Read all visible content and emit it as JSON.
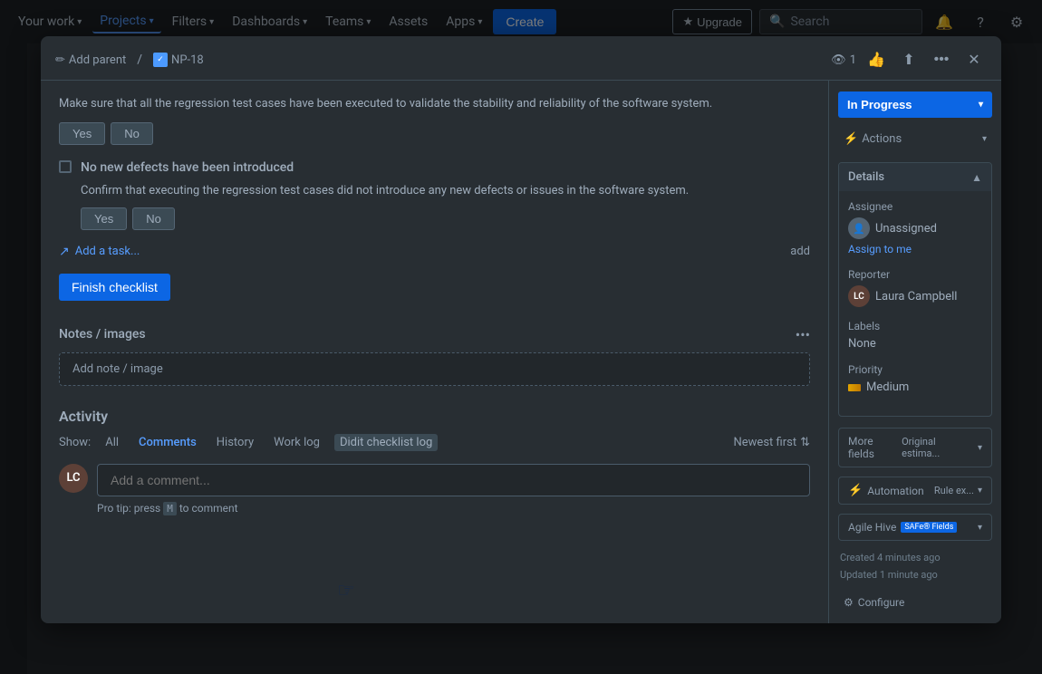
{
  "topnav": {
    "items": [
      {
        "label": "Your work",
        "hasChevron": true,
        "active": false
      },
      {
        "label": "Projects",
        "hasChevron": true,
        "active": true
      },
      {
        "label": "Filters",
        "hasChevron": true,
        "active": false
      },
      {
        "label": "Dashboards",
        "hasChevron": true,
        "active": false
      },
      {
        "label": "Teams",
        "hasChevron": true,
        "active": false
      },
      {
        "label": "Assets",
        "hasChevron": false,
        "active": false
      },
      {
        "label": "Apps",
        "hasChevron": true,
        "active": false
      }
    ],
    "create_label": "Create",
    "upgrade_label": "Upgrade",
    "search_placeholder": "Search"
  },
  "modal": {
    "breadcrumb_parent": "Add parent",
    "breadcrumb_sep": "/",
    "breadcrumb_id": "NP-18",
    "watch_count": "1",
    "status": "In Progress",
    "actions_label": "Actions",
    "checklist": {
      "description": "Make sure that all the regression test cases have been executed to validate the stability and reliability of the software system.",
      "yes_label": "Yes",
      "no_label": "No",
      "item_title": "No new defects have been introduced",
      "item_description": "Confirm that executing the regression test cases did not introduce any new defects or issues in the software system.",
      "add_task_label": "Add a task...",
      "add_label": "add"
    },
    "finish_checklist_label": "Finish checklist",
    "notes": {
      "title": "Notes / images",
      "add_label": "Add note / image"
    },
    "activity": {
      "title": "Activity",
      "show_label": "Show:",
      "filters": [
        {
          "label": "All",
          "active": false
        },
        {
          "label": "Comments",
          "active": true
        },
        {
          "label": "History",
          "active": false
        },
        {
          "label": "Work log",
          "active": false
        },
        {
          "label": "Didit checklist log",
          "active": true
        }
      ],
      "newest_first": "Newest first",
      "comment_placeholder": "Add a comment...",
      "pro_tip_text": "Pro tip: press",
      "pro_tip_key": "M",
      "pro_tip_suffix": "to comment"
    },
    "sidebar": {
      "status_label": "In Progress",
      "actions_label": "Actions",
      "details_label": "Details",
      "assignee_label": "Assignee",
      "assignee_value": "Unassigned",
      "assign_me_label": "Assign to me",
      "reporter_label": "Reporter",
      "reporter_value": "Laura Campbell",
      "labels_label": "Labels",
      "labels_value": "None",
      "priority_label": "Priority",
      "priority_value": "Medium",
      "more_fields_label": "More fields",
      "more_fields_sub": "Original estima...",
      "automation_label": "Automation",
      "automation_sub": "Rule ex...",
      "agile_hive_label": "Agile Hive",
      "agile_fields_label": "SAFe® Fields",
      "created_label": "Created 4 minutes ago",
      "updated_label": "Updated 1 minute ago",
      "configure_label": "Configure"
    }
  }
}
